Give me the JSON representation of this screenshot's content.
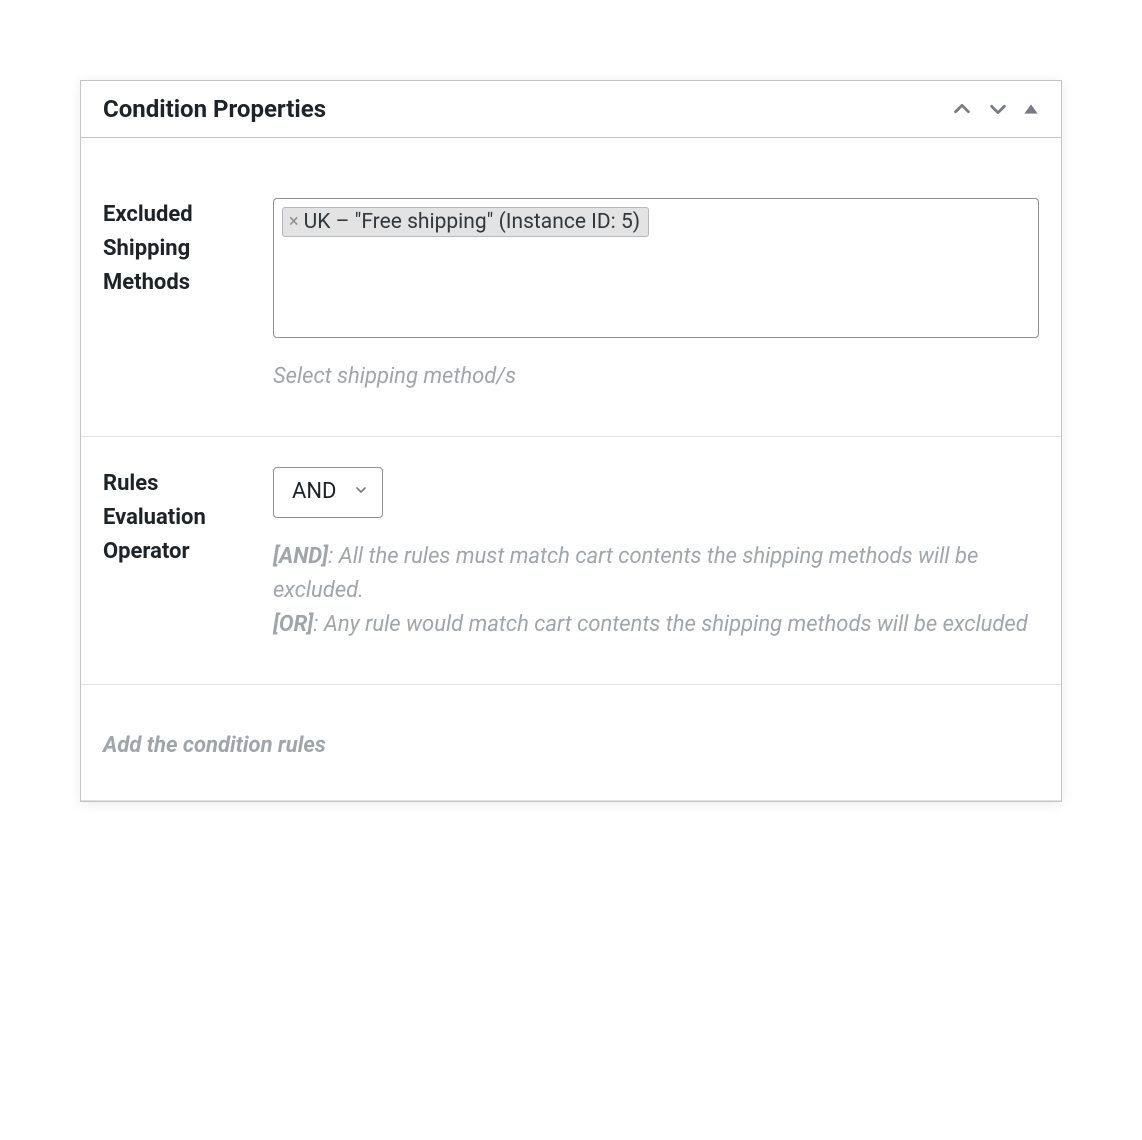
{
  "panel": {
    "title": "Condition Properties"
  },
  "excluded_methods": {
    "label": "Excluded Shipping Methods",
    "tags": [
      {
        "label": "UK – \"Free shipping\" (Instance ID: 5)"
      }
    ],
    "helper": "Select shipping method/s"
  },
  "operator": {
    "label": "Rules Evaluation Operator",
    "selected": "AND",
    "helper_and_prefix": "[AND]",
    "helper_and_text": ": All the rules must match cart contents the shipping methods will be excluded.",
    "helper_or_prefix": "[OR]",
    "helper_or_text": ": Any rule would match cart contents the shipping methods will be excluded"
  },
  "footer": {
    "text": "Add the condition rules"
  }
}
